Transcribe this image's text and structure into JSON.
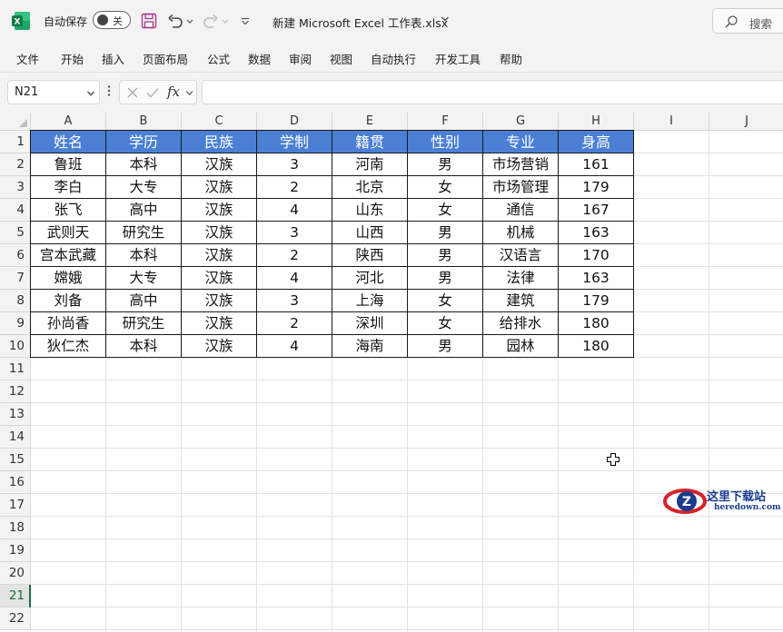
{
  "titlebar": {
    "app_icon": "excel-logo-icon",
    "autosave_label": "自动保存",
    "autosave_state": "关",
    "doc_title": "新建 Microsoft Excel 工作表.xlsx",
    "search_placeholder": "搜索"
  },
  "menu": {
    "items": [
      "文件",
      "开始",
      "插入",
      "页面布局",
      "公式",
      "数据",
      "审阅",
      "视图",
      "自动执行",
      "开发工具",
      "帮助"
    ]
  },
  "formula_bar": {
    "name_box": "N21",
    "fx_label": "fx",
    "formula": ""
  },
  "sheet": {
    "columns": [
      "A",
      "B",
      "C",
      "D",
      "E",
      "F",
      "G",
      "H",
      "I",
      "J"
    ],
    "rows": [
      "1",
      "2",
      "3",
      "4",
      "5",
      "6",
      "7",
      "8",
      "9",
      "10",
      "11",
      "12",
      "13",
      "14",
      "15",
      "16",
      "17",
      "18",
      "19",
      "20",
      "21",
      "22"
    ],
    "selected_row": "21",
    "table_header": [
      "姓名",
      "学历",
      "民族",
      "学制",
      "籍贯",
      "性别",
      "专业",
      "身高"
    ],
    "table_rows": [
      [
        "鲁班",
        "本科",
        "汉族",
        "3",
        "河南",
        "男",
        "市场营销",
        "161"
      ],
      [
        "李白",
        "大专",
        "汉族",
        "2",
        "北京",
        "女",
        "市场管理",
        "179"
      ],
      [
        "张飞",
        "高中",
        "汉族",
        "4",
        "山东",
        "女",
        "通信",
        "167"
      ],
      [
        "武则天",
        "研究生",
        "汉族",
        "3",
        "山西",
        "男",
        "机械",
        "163"
      ],
      [
        "宫本武藏",
        "本科",
        "汉族",
        "2",
        "陕西",
        "男",
        "汉语言",
        "170"
      ],
      [
        "嫦娥",
        "大专",
        "汉族",
        "4",
        "河北",
        "男",
        "法律",
        "163"
      ],
      [
        "刘备",
        "高中",
        "汉族",
        "3",
        "上海",
        "女",
        "建筑",
        "179"
      ],
      [
        "孙尚香",
        "研究生",
        "汉族",
        "2",
        "深圳",
        "女",
        "给排水",
        "180"
      ],
      [
        "狄仁杰",
        "本科",
        "汉族",
        "4",
        "海南",
        "男",
        "园林",
        "180"
      ]
    ]
  },
  "watermark": {
    "line1": "这里下载站",
    "line2": "heredown.com"
  },
  "colors": {
    "header_fill": "#4a7fd4",
    "excel_green": "#1e7145"
  }
}
